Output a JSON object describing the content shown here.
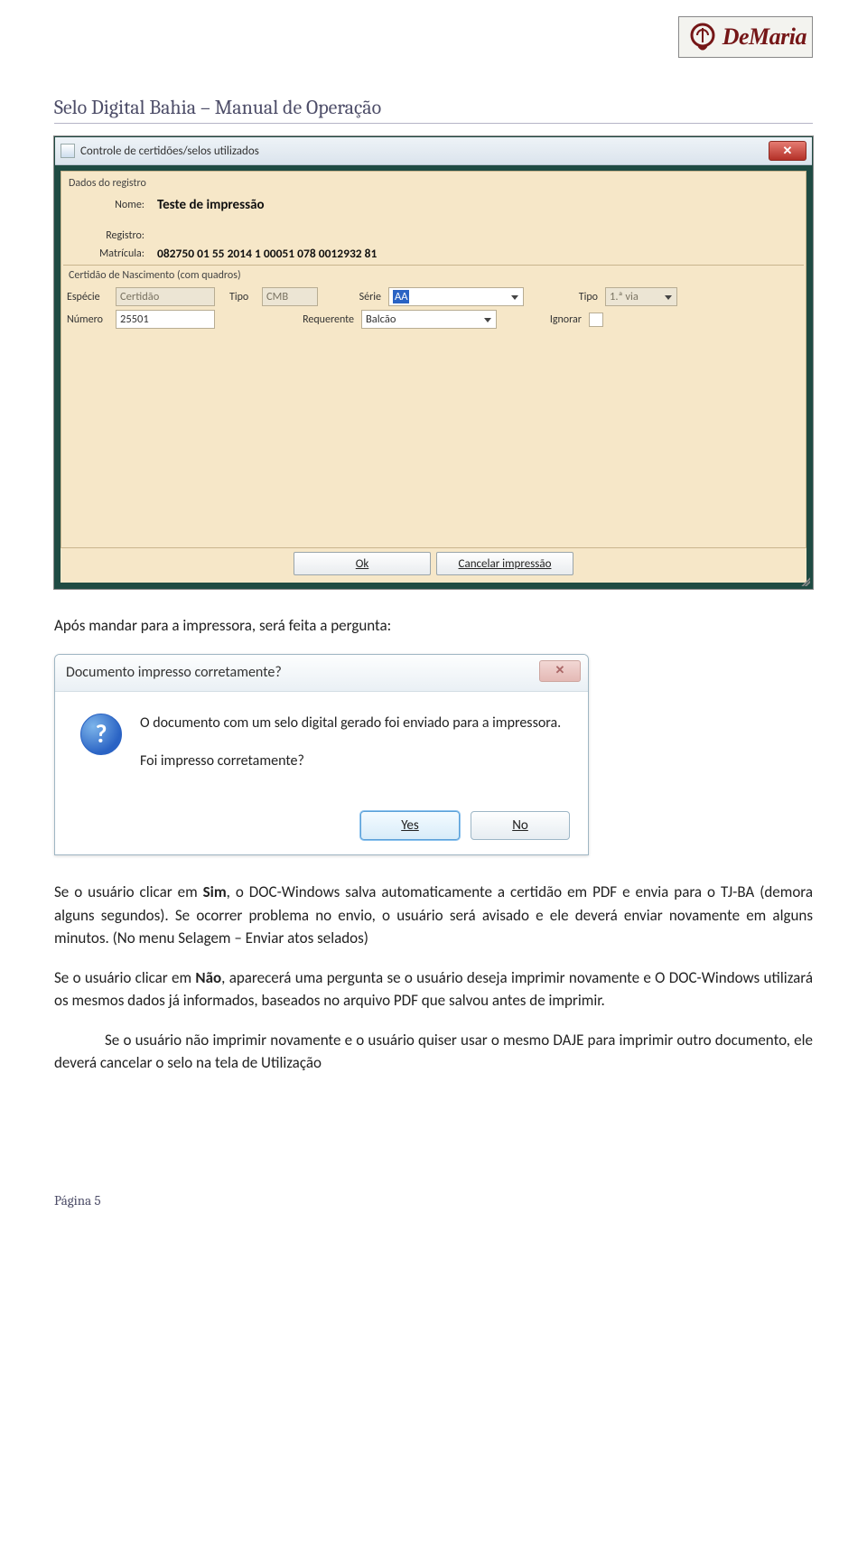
{
  "logo": {
    "text": "DeMaria"
  },
  "doc_title": "Selo Digital Bahia – Manual de Operação",
  "app": {
    "title": "Controle de certidões/selos utilizados",
    "group_registro": "Dados do registro",
    "nome_lbl": "Nome:",
    "nome_val": "Teste de impressão",
    "registro_lbl": "Registro:",
    "registro_val": "",
    "matricula_lbl": "Matrícula:",
    "matricula_val": "082750 01 55 2014 1 00051 078 0012932 81",
    "group_certidao": "Certidão de Nascimento (com quadros)",
    "fields": {
      "especie_lbl": "Espécie",
      "especie_val": "Certidão",
      "tipo1_lbl": "Tipo",
      "tipo1_val": "CMB",
      "serie_lbl": "Série",
      "serie_val": "AA",
      "tipo2_lbl": "Tipo",
      "tipo2_val": "1.ª via",
      "numero_lbl": "Número",
      "numero_val": "25501",
      "requerente_lbl": "Requerente",
      "requerente_val": "Balcão",
      "ignorar_lbl": "Ignorar"
    },
    "buttons": {
      "ok": "Ok",
      "cancel": "Cancelar impressão"
    }
  },
  "text": {
    "p1": "Após mandar para a impressora, será feita a pergunta:",
    "p2a": "Se o usuário clicar em ",
    "p2b_bold": "Sim",
    "p2c": ", o DOC-Windows salva automaticamente a certidão em PDF e envia para o TJ-BA (demora alguns segundos). Se ocorrer problema no envio, o usuário será avisado e ele deverá enviar novamente em alguns minutos. (No menu Selagem – Enviar atos selados)",
    "p3a": "Se o usuário clicar em ",
    "p3b_bold": "Não",
    "p3c": ", aparecerá uma pergunta se o usuário deseja imprimir novamente e O DOC-Windows utilizará os mesmos dados já informados, baseados no arquivo PDF que salvou antes de imprimir.",
    "p4": "Se o usuário não imprimir novamente e o usuário quiser usar o mesmo DAJE para imprimir outro documento, ele deverá cancelar o selo na tela de Utilização"
  },
  "dialog": {
    "title": "Documento impresso corretamente?",
    "line1": "O documento com um selo digital gerado foi enviado para a impressora.",
    "line2": "Foi impresso corretamente?",
    "yes": "Yes",
    "no": "No"
  },
  "footer": "Página 5"
}
